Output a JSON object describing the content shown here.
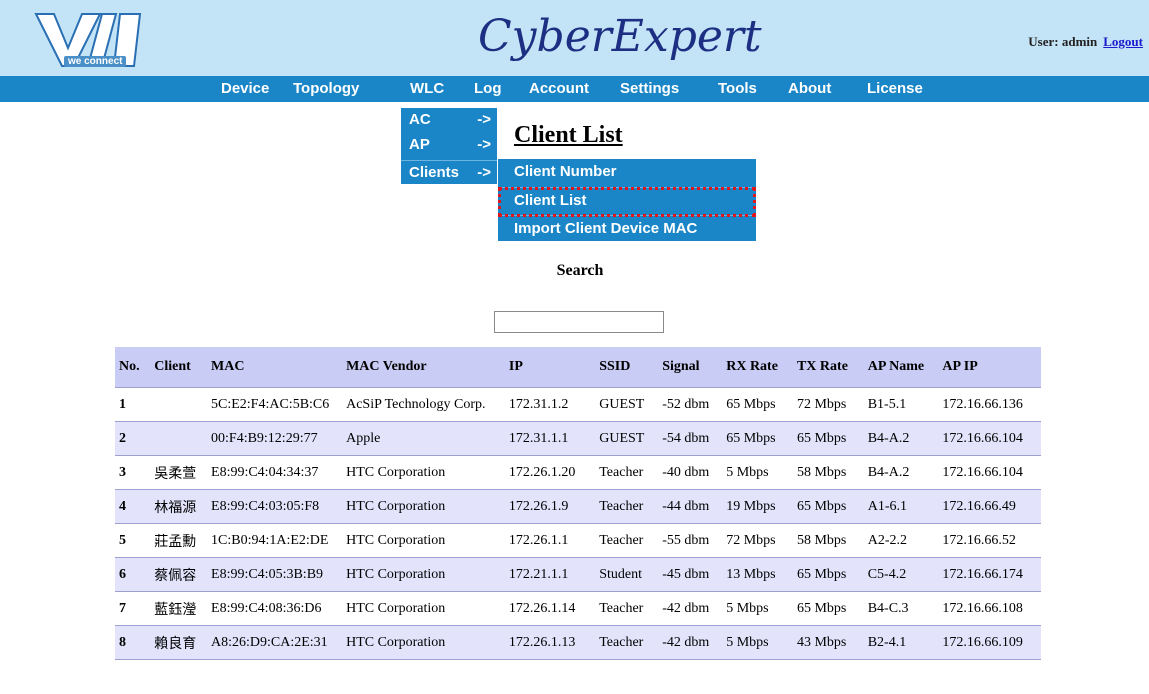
{
  "header": {
    "logo_text": "VIA",
    "logo_tagline": "we connect",
    "brand_title": "CyberExpert",
    "user_label": "User: admin",
    "logout_label": "Logout"
  },
  "nav": {
    "items": [
      "Device",
      "Topology",
      "WLC",
      "Log",
      "Account",
      "Settings",
      "Tools",
      "About",
      "License"
    ]
  },
  "wlc_menu": {
    "items": [
      {
        "label": "AC",
        "arrow": "->"
      },
      {
        "label": "AP",
        "arrow": "->"
      },
      {
        "label": "Clients",
        "arrow": "->"
      }
    ]
  },
  "clients_submenu": {
    "items": [
      "Client Number",
      "Client List",
      "Import Client Device MAC"
    ],
    "selected": "Client List"
  },
  "page": {
    "title": "Client List",
    "search_label": "Search",
    "search_value": ""
  },
  "table": {
    "headers": [
      "No.",
      "Client",
      "MAC",
      "MAC Vendor",
      "IP",
      "SSID",
      "Signal",
      "RX Rate",
      "TX Rate",
      "AP Name",
      "AP IP"
    ],
    "rows": [
      [
        "1",
        "",
        "5C:E2:F4:AC:5B:C6",
        "AcSiP Technology Corp.",
        "172.31.1.2",
        "GUEST",
        "-52 dbm",
        "65 Mbps",
        "72 Mbps",
        "B1-5.1",
        "172.16.66.136"
      ],
      [
        "2",
        "",
        "00:F4:B9:12:29:77",
        "Apple",
        "172.31.1.1",
        "GUEST",
        "-54 dbm",
        "65 Mbps",
        "65 Mbps",
        "B4-A.2",
        "172.16.66.104"
      ],
      [
        "3",
        "吳柔萱",
        "E8:99:C4:04:34:37",
        "HTC Corporation",
        "172.26.1.20",
        "Teacher",
        "-40 dbm",
        "5 Mbps",
        "58 Mbps",
        "B4-A.2",
        "172.16.66.104"
      ],
      [
        "4",
        "林福源",
        "E8:99:C4:03:05:F8",
        "HTC Corporation",
        "172.26.1.9",
        "Teacher",
        "-44 dbm",
        "19 Mbps",
        "65 Mbps",
        "A1-6.1",
        "172.16.66.49"
      ],
      [
        "5",
        "莊孟勳",
        "1C:B0:94:1A:E2:DE",
        "HTC Corporation",
        "172.26.1.1",
        "Teacher",
        "-55 dbm",
        "72 Mbps",
        "58 Mbps",
        "A2-2.2",
        "172.16.66.52"
      ],
      [
        "6",
        "蔡佩容",
        "E8:99:C4:05:3B:B9",
        "HTC Corporation",
        "172.21.1.1",
        "Student",
        "-45 dbm",
        "13 Mbps",
        "65 Mbps",
        "C5-4.2",
        "172.16.66.174"
      ],
      [
        "7",
        "藍鈺瀅",
        "E8:99:C4:08:36:D6",
        "HTC Corporation",
        "172.26.1.14",
        "Teacher",
        "-42 dbm",
        "5 Mbps",
        "65 Mbps",
        "B4-C.3",
        "172.16.66.108"
      ],
      [
        "8",
        "賴良育",
        "A8:26:D9:CA:2E:31",
        "HTC Corporation",
        "172.26.1.13",
        "Teacher",
        "-42 dbm",
        "5 Mbps",
        "43 Mbps",
        "B2-4.1",
        "172.16.66.109"
      ]
    ]
  },
  "colors": {
    "header_bg": "#c3e3f6",
    "nav_bg": "#1a86c7",
    "brand_text": "#1d2f82",
    "table_header_bg": "#c9cdf6",
    "table_alt_row_bg": "#e3e4fc",
    "highlight_border": "#e0161c"
  }
}
